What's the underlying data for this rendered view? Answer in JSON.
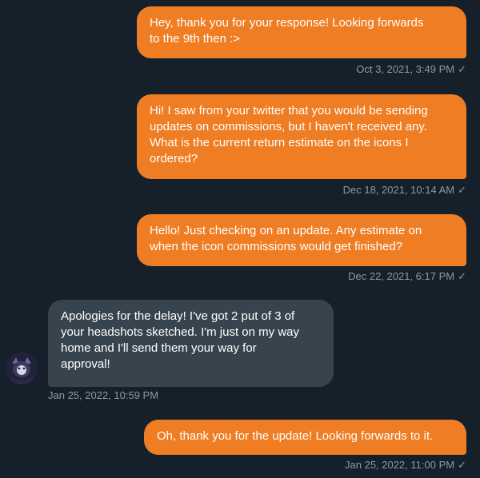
{
  "messages": [
    {
      "direction": "sent",
      "text": "Hey, thank you for your response! Looking forwards\nto the 9th then :>",
      "timestamp": "Oct 3, 2021, 3:49 PM",
      "read_icon": "check-icon"
    },
    {
      "direction": "sent",
      "text": "Hi! I saw from your twitter that you would be sending\nupdates on commissions, but I haven't received any.\nWhat is the current return estimate on the icons I\nordered?",
      "timestamp": "Dec 18, 2021, 10:14 AM",
      "read_icon": "check-icon"
    },
    {
      "direction": "sent",
      "text": "Hello! Just checking on an update. Any estimate on\nwhen the icon commissions would get finished?",
      "timestamp": "Dec 22, 2021, 6:17 PM",
      "read_icon": "check-icon"
    },
    {
      "direction": "received",
      "text": "Apologies for the delay! I've got 2 put of 3 of\nyour headshots sketched. I'm just on my way\nhome and I'll send them your way for\napproval!",
      "timestamp": "Jan 25, 2022, 10:59 PM",
      "avatar_icon": "avatar-icon"
    },
    {
      "direction": "sent",
      "text": "Oh, thank you for the update! Looking forwards to it.",
      "timestamp": "Jan 25, 2022, 11:00 PM",
      "read_icon": "check-icon"
    }
  ],
  "check_glyph": "✓",
  "colors": {
    "background": "#15202b",
    "sent_bubble": "#ef7d23",
    "received_bubble": "#38444d",
    "timestamp": "#8b98a5"
  }
}
